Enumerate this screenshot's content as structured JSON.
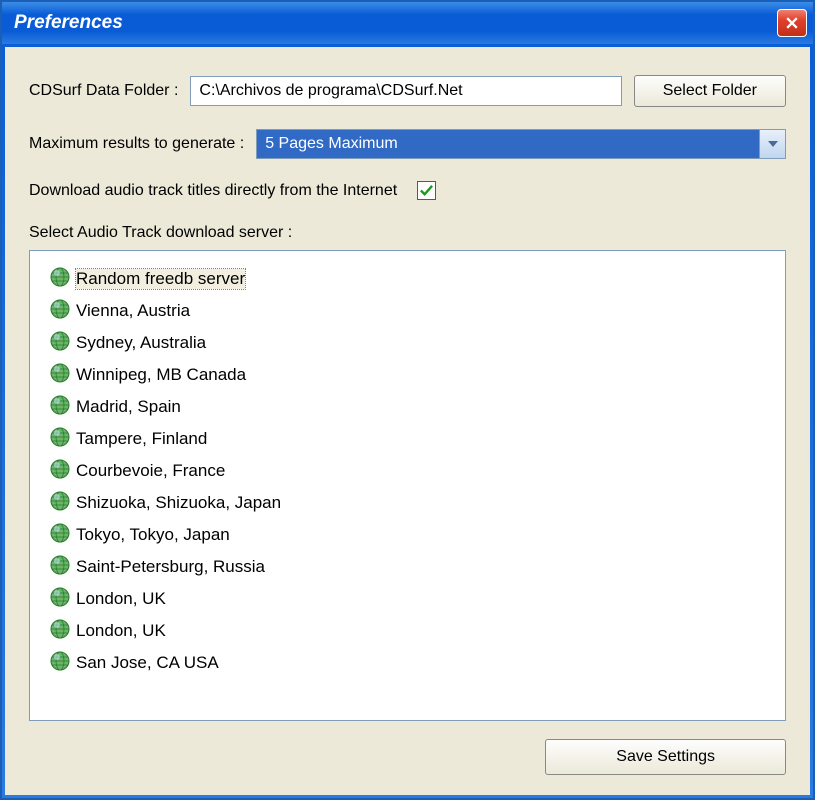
{
  "window": {
    "title": "Preferences"
  },
  "fields": {
    "data_folder_label": "CDSurf Data Folder :",
    "data_folder_value": "C:\\Archivos de programa\\CDSurf.Net",
    "select_folder_btn": "Select Folder",
    "max_results_label": "Maximum results to generate :",
    "max_results_value": "5 Pages Maximum",
    "download_titles_label": "Download audio track titles directly from the Internet",
    "download_titles_checked": true,
    "server_label": "Select Audio Track download server :"
  },
  "servers": [
    "Random freedb server",
    "Vienna, Austria",
    "Sydney, Australia",
    "Winnipeg, MB Canada",
    "Madrid, Spain",
    "Tampere, Finland",
    "Courbevoie, France",
    "Shizuoka, Shizuoka, Japan",
    "Tokyo, Tokyo, Japan",
    "Saint-Petersburg, Russia",
    "London, UK",
    "London, UK",
    "San Jose, CA USA"
  ],
  "selected_server_index": 0,
  "footer": {
    "save_btn": "Save Settings"
  }
}
